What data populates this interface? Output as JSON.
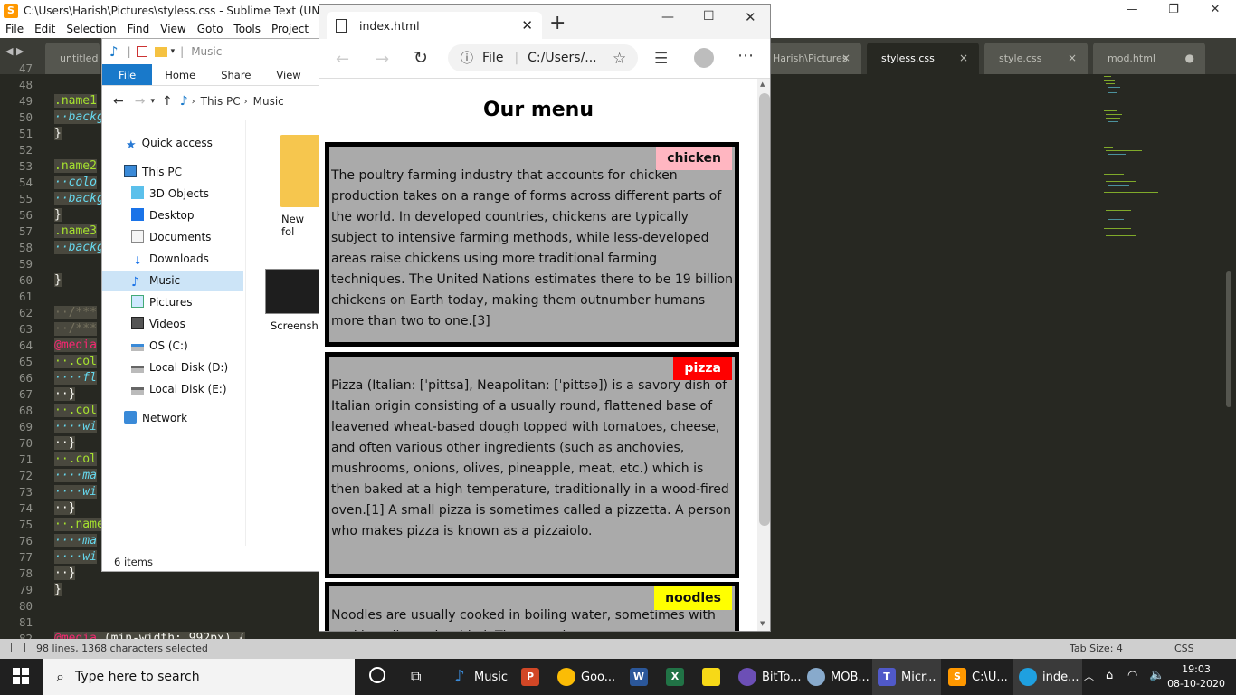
{
  "sublime": {
    "title": "C:\\Users\\Harish\\Pictures\\styless.css - Sublime Text (UNREGISTERED)",
    "menu": [
      "File",
      "Edit",
      "Selection",
      "Find",
      "View",
      "Goto",
      "Tools",
      "Project",
      "P"
    ],
    "tabs": [
      {
        "label": "untitled",
        "close": ""
      },
      {
        "label": "Harish\\Pictures",
        "close": "×"
      },
      {
        "label": "styless.css",
        "close": "×"
      },
      {
        "label": "style.css",
        "close": "×"
      },
      {
        "label": "mod.html",
        "close": "●"
      }
    ],
    "line_numbers": [
      "47",
      "48",
      "49",
      "50",
      "51",
      "52",
      "53",
      "54",
      "55",
      "56",
      "57",
      "58",
      "59",
      "60",
      "61",
      "62",
      "63",
      "64",
      "65",
      "66",
      "67",
      "68",
      "69",
      "70",
      "71",
      "72",
      "73",
      "74",
      "75",
      "76",
      "77",
      "78",
      "79",
      "80",
      "81",
      "82"
    ],
    "code": {
      "l49": ".name1",
      "l50": "··backg",
      "l51": "}",
      "l53": ".name2",
      "l54": "··colo",
      "l55": "··backg",
      "l56": "}",
      "l57": ".name3",
      "l58": "··backg",
      "l60": "}",
      "l62": "··/***",
      "l63": "··/***",
      "l64": "@media",
      "l65": "··.col",
      "l66": "····fl",
      "l67": "··}",
      "l68": "··.col",
      "l69": "····wi",
      "l70": "··}",
      "l71": "··.col",
      "l72": "····ma",
      "l73": "····wi",
      "l74": "··}",
      "l75": "··.name",
      "l76": "····ma",
      "l77": "····wi",
      "l78": "··}",
      "l79": "}",
      "l82_kw": "@media",
      "l82_rest": " (min-width: 992px) {"
    },
    "status_left": "98 lines, 1368 characters selected",
    "tab_size": "Tab Size: 4",
    "syntax": "CSS"
  },
  "explorer": {
    "location": "Music",
    "ribbon": [
      "File",
      "Home",
      "Share",
      "View"
    ],
    "breadcrumb": [
      "This PC",
      "Music"
    ],
    "nav": [
      {
        "label": "Quick access",
        "icon": "star-icon"
      },
      {
        "label": "This PC",
        "icon": "computer-icon"
      },
      {
        "label": "3D Objects",
        "icon": "cube-icon"
      },
      {
        "label": "Desktop",
        "icon": "desktop-icon"
      },
      {
        "label": "Documents",
        "icon": "document-icon"
      },
      {
        "label": "Downloads",
        "icon": "download-icon"
      },
      {
        "label": "Music",
        "icon": "music-icon"
      },
      {
        "label": "Pictures",
        "icon": "pictures-icon"
      },
      {
        "label": "Videos",
        "icon": "video-icon"
      },
      {
        "label": "OS (C:)",
        "icon": "drive-icon"
      },
      {
        "label": "Local Disk (D:)",
        "icon": "drive-icon"
      },
      {
        "label": "Local Disk (E:)",
        "icon": "drive-icon"
      },
      {
        "label": "Network",
        "icon": "network-icon"
      }
    ],
    "items": [
      "New fol",
      "Screensho"
    ],
    "status": "6 items"
  },
  "edge": {
    "tab_title": "index.html",
    "new_tab": "+",
    "address_scheme": "File",
    "address": "C:/Users/...",
    "page": {
      "heading": "Our menu",
      "cards": [
        {
          "tag": "chicken",
          "tag_color": "#ffb6c1",
          "text": "The poultry farming industry that accounts for chicken production takes on a range of forms across different parts of the world. In developed countries, chickens are typically subject to intensive farming methods, while less-developed areas raise chickens using more traditional farming techniques. The United Nations estimates there to be 19 billion chickens on Earth today, making them outnumber humans more than two to one.[3]"
        },
        {
          "tag": "pizza",
          "tag_color": "#ff0000",
          "text": "Pizza (Italian: [ˈpittsa], Neapolitan: [ˈpittsə]) is a savory dish of Italian origin consisting of a usually round, flattened base of leavened wheat-based dough topped with tomatoes, cheese, and often various other ingredients (such as anchovies, mushrooms, onions, olives, pineapple, meat, etc.) which is then baked at a high temperature, traditionally in a wood-fired oven.[1] A small pizza is sometimes called a pizzetta. A person who makes pizza is known as a pizzaiolo."
        },
        {
          "tag": "noodles",
          "tag_color": "#ffff00",
          "text": "Noodles are usually cooked in boiling water, sometimes with cooking oil or salt added. They are also"
        }
      ]
    }
  },
  "taskbar": {
    "search_placeholder": "Type here to search",
    "apps": [
      {
        "label": "Music"
      },
      {
        "label": "Goo..."
      },
      {
        "label": "BitTo..."
      },
      {
        "label": "MOB..."
      },
      {
        "label": "Micr..."
      },
      {
        "label": "C:\\U..."
      },
      {
        "label": "inde..."
      }
    ],
    "time": "19:03",
    "date": "08-10-2020"
  }
}
